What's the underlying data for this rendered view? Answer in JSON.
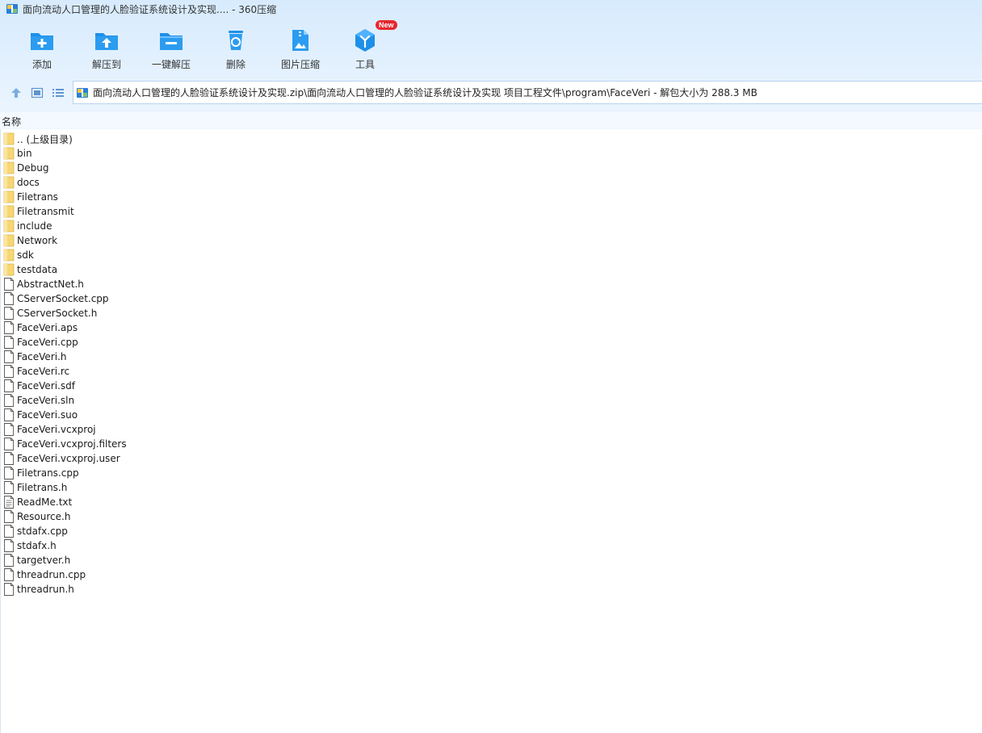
{
  "window": {
    "title": "面向流动人口管理的人脸验证系统设计及实现.... - 360压缩"
  },
  "toolbar": [
    {
      "label": "添加",
      "icon": "add-folder-icon"
    },
    {
      "label": "解压到",
      "icon": "extract-to-icon"
    },
    {
      "label": "一键解压",
      "icon": "one-click-extract-icon"
    },
    {
      "label": "删除",
      "icon": "recycle-bin-icon"
    },
    {
      "label": "图片压缩",
      "icon": "image-compress-icon"
    },
    {
      "label": "工具",
      "icon": "tools-icon",
      "badge": "New"
    }
  ],
  "nav": {
    "path": "面向流动人口管理的人脸验证系统设计及实现.zip\\面向流动人口管理的人脸验证系统设计及实现 项目工程文件\\program\\FaceVeri - 解包大小为 288.3 MB"
  },
  "list": {
    "column_name": "名称",
    "items": [
      {
        "name": ".. (上级目录)",
        "kind": "folder"
      },
      {
        "name": "bin",
        "kind": "folder"
      },
      {
        "name": "Debug",
        "kind": "folder"
      },
      {
        "name": "docs",
        "kind": "folder"
      },
      {
        "name": "Filetrans",
        "kind": "folder"
      },
      {
        "name": "Filetransmit",
        "kind": "folder"
      },
      {
        "name": "include",
        "kind": "folder"
      },
      {
        "name": "Network",
        "kind": "folder"
      },
      {
        "name": "sdk",
        "kind": "folder"
      },
      {
        "name": "testdata",
        "kind": "folder"
      },
      {
        "name": "AbstractNet.h",
        "kind": "file"
      },
      {
        "name": "CServerSocket.cpp",
        "kind": "file"
      },
      {
        "name": "CServerSocket.h",
        "kind": "file"
      },
      {
        "name": "FaceVeri.aps",
        "kind": "file"
      },
      {
        "name": "FaceVeri.cpp",
        "kind": "file"
      },
      {
        "name": "FaceVeri.h",
        "kind": "file"
      },
      {
        "name": "FaceVeri.rc",
        "kind": "file"
      },
      {
        "name": "FaceVeri.sdf",
        "kind": "file"
      },
      {
        "name": "FaceVeri.sln",
        "kind": "file"
      },
      {
        "name": "FaceVeri.suo",
        "kind": "file"
      },
      {
        "name": "FaceVeri.vcxproj",
        "kind": "file"
      },
      {
        "name": "FaceVeri.vcxproj.filters",
        "kind": "file"
      },
      {
        "name": "FaceVeri.vcxproj.user",
        "kind": "file"
      },
      {
        "name": "Filetrans.cpp",
        "kind": "file"
      },
      {
        "name": "Filetrans.h",
        "kind": "file"
      },
      {
        "name": "ReadMe.txt",
        "kind": "text"
      },
      {
        "name": "Resource.h",
        "kind": "file"
      },
      {
        "name": "stdafx.cpp",
        "kind": "file"
      },
      {
        "name": "stdafx.h",
        "kind": "file"
      },
      {
        "name": "targetver.h",
        "kind": "file"
      },
      {
        "name": "threadrun.cpp",
        "kind": "file"
      },
      {
        "name": "threadrun.h",
        "kind": "file"
      }
    ]
  },
  "colors": {
    "accent": "#1e90e8",
    "folder": "#f7d774",
    "badge": "#e6262e"
  }
}
